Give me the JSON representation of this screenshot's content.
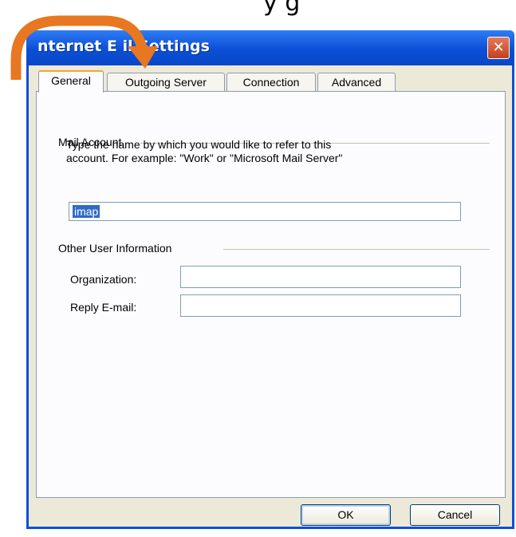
{
  "top_text": "y                                                g",
  "window": {
    "title": "nternet E    il Settings",
    "close_glyph": "✕"
  },
  "tabs": [
    {
      "label": "General",
      "active": true
    },
    {
      "label": "Outgoing Server",
      "active": false
    },
    {
      "label": "Connection",
      "active": false
    },
    {
      "label": "Advanced",
      "active": false
    }
  ],
  "mail_account": {
    "heading": "Mail Account",
    "description_line1": "Type the name by which you would like to refer to this",
    "description_line2": "account.  For example: \"Work\" or \"Microsoft Mail Server\"",
    "value": "imap"
  },
  "other_info": {
    "heading": "Other User Information",
    "organization_label": "Organization:",
    "organization_value": "",
    "reply_label": "Reply E-mail:",
    "reply_value": ""
  },
  "buttons": {
    "ok": "OK",
    "cancel": "Cancel"
  },
  "colors": {
    "titlebar": "#0b4fd6",
    "arrow": "#e87722",
    "selection": "#316ac5"
  }
}
